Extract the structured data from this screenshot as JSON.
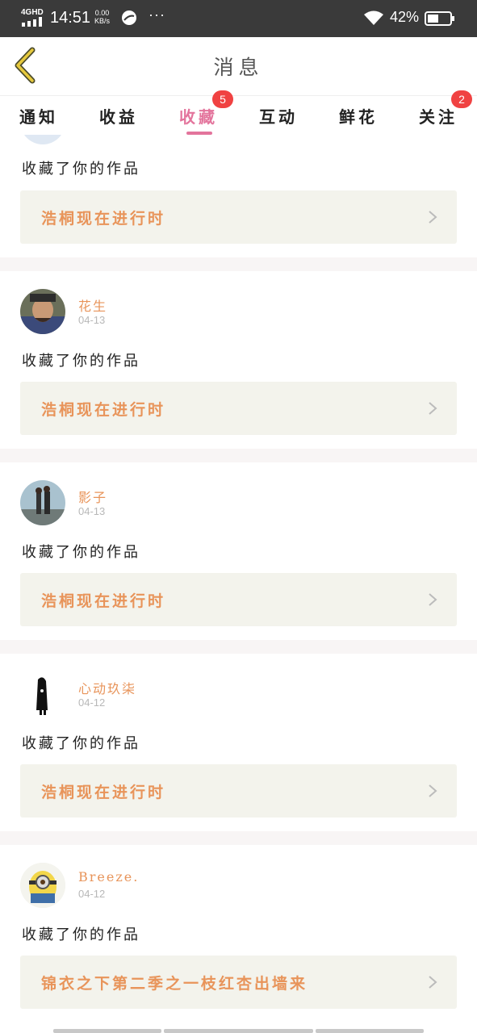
{
  "status_bar": {
    "network": "4GHD",
    "time": "14:51",
    "speed_value": "0.00",
    "speed_unit": "KB/s",
    "more": "···",
    "battery_percent": "42%"
  },
  "header": {
    "title": "消息"
  },
  "tabs": [
    {
      "label": "通知",
      "active": false
    },
    {
      "label": "收益",
      "active": false
    },
    {
      "label": "收藏",
      "active": true,
      "badge": "5"
    },
    {
      "label": "互动",
      "active": false
    },
    {
      "label": "鲜花",
      "active": false
    },
    {
      "label": "关注",
      "active": false,
      "badge": "2"
    }
  ],
  "feed": [
    {
      "name": "",
      "date": "",
      "action": "收藏了你的作品",
      "work": "浩桐现在进行时"
    },
    {
      "name": "花生",
      "date": "04-13",
      "action": "收藏了你的作品",
      "work": "浩桐现在进行时"
    },
    {
      "name": "影子",
      "date": "04-13",
      "action": "收藏了你的作品",
      "work": "浩桐现在进行时"
    },
    {
      "name": "心动玖柒",
      "date": "04-12",
      "action": "收藏了你的作品",
      "work": "浩桐现在进行时"
    },
    {
      "name": "Breeze.",
      "date": "04-12",
      "action": "收藏了你的作品",
      "work": "锦衣之下第二季之一枝红杏出墙来"
    }
  ],
  "colors": {
    "accent_pink": "#e3749c",
    "name_orange": "#e8945a",
    "badge_red": "#f04242",
    "work_bg": "#f3f3ec"
  },
  "icons": {
    "back": "chevron-left-icon",
    "chevron": "chevron-right-icon"
  }
}
